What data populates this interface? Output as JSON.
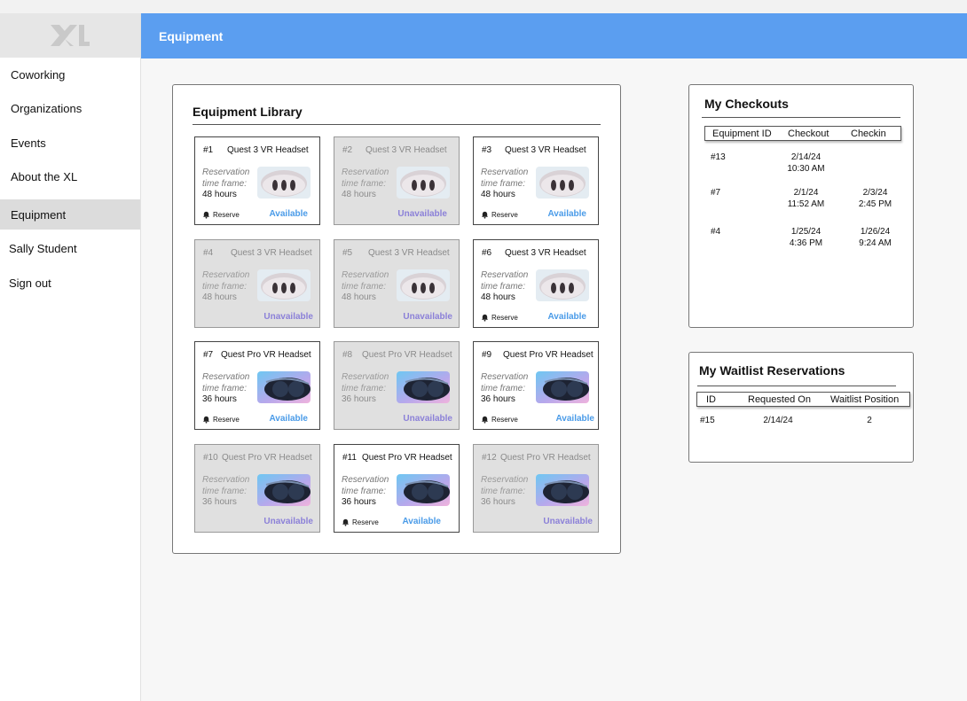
{
  "app": {
    "logo_text": "XL"
  },
  "header": {
    "title": "Equipment"
  },
  "sidebar": {
    "items": [
      {
        "label": "Coworking"
      },
      {
        "label": "Organizations"
      },
      {
        "label": "Events"
      },
      {
        "label": "About the XL"
      },
      {
        "label": "Equipment",
        "active": true
      },
      {
        "label": "Sally Student"
      },
      {
        "label": "Sign out"
      }
    ]
  },
  "library": {
    "title": "Equipment Library",
    "reservation_label_1": "Reservation",
    "reservation_label_2": "time frame:",
    "reserve_label": "Reserve",
    "cards": [
      {
        "num": "#1",
        "name": "Quest 3 VR Headset",
        "duration": "48 hours",
        "status": "Available",
        "available": true,
        "image": "quest-3-headset"
      },
      {
        "num": "#2",
        "name": "Quest 3 VR Headset",
        "duration": "48 hours",
        "status": "Unavailable",
        "available": false,
        "image": "quest-3-headset"
      },
      {
        "num": "#3",
        "name": "Quest 3 VR Headset",
        "duration": "48 hours",
        "status": "Available",
        "available": true,
        "image": "quest-3-headset"
      },
      {
        "num": "#4",
        "name": "Quest 3 VR Headset",
        "duration": "48 hours",
        "status": "Unavailable",
        "available": false,
        "image": "quest-3-headset"
      },
      {
        "num": "#5",
        "name": "Quest 3 VR Headset",
        "duration": "48 hours",
        "status": "Unavailable",
        "available": false,
        "image": "quest-3-headset"
      },
      {
        "num": "#6",
        "name": "Quest 3 VR Headset",
        "duration": "48 hours",
        "status": "Available",
        "available": true,
        "image": "quest-3-headset"
      },
      {
        "num": "#7",
        "name": "Quest Pro VR Headset",
        "duration": "36 hours",
        "status": "Available",
        "available": true,
        "image": "quest-pro-headset"
      },
      {
        "num": "#8",
        "name": "Quest Pro VR Headset",
        "duration": "36 hours",
        "status": "Unavailable",
        "available": false,
        "image": "quest-pro-headset"
      },
      {
        "num": "#9",
        "name": "Quest Pro VR Headset",
        "duration": "36 hours",
        "status": "Available",
        "available": true,
        "image": "quest-pro-headset"
      },
      {
        "num": "#10",
        "name": "Quest Pro VR Headset",
        "duration": "36 hours",
        "status": "Unavailable",
        "available": false,
        "image": "quest-pro-headset"
      },
      {
        "num": "#11",
        "name": "Quest Pro VR Headset",
        "duration": "36 hours",
        "status": "Available",
        "available": true,
        "image": "quest-pro-headset"
      },
      {
        "num": "#12",
        "name": "Quest Pro VR Headset",
        "duration": "36 hours",
        "status": "Unavailable",
        "available": false,
        "image": "quest-pro-headset"
      }
    ]
  },
  "checkouts": {
    "title": "My Checkouts",
    "columns": [
      "Equipment ID",
      "Checkout",
      "Checkin"
    ],
    "rows": [
      {
        "id": "#13",
        "checkout_date": "2/14/24",
        "checkout_time": "10:30 AM",
        "checkin_date": "",
        "checkin_time": ""
      },
      {
        "id": "#7",
        "checkout_date": "2/1/24",
        "checkout_time": "11:52 AM",
        "checkin_date": "2/3/24",
        "checkin_time": "2:45 PM"
      },
      {
        "id": "#4",
        "checkout_date": "1/25/24",
        "checkout_time": "4:36 PM",
        "checkin_date": "1/26/24",
        "checkin_time": "9:24 AM"
      }
    ]
  },
  "waitlist": {
    "title": "My Waitlist Reservations",
    "columns": [
      "ID",
      "Requested On",
      "Waitlist Position"
    ],
    "rows": [
      {
        "id": "#15",
        "requested_on": "2/14/24",
        "position": "2"
      }
    ]
  },
  "colors": {
    "header_blue": "#5b9ef0",
    "available": "#4a9be8",
    "unavailable": "#8b80d8"
  }
}
